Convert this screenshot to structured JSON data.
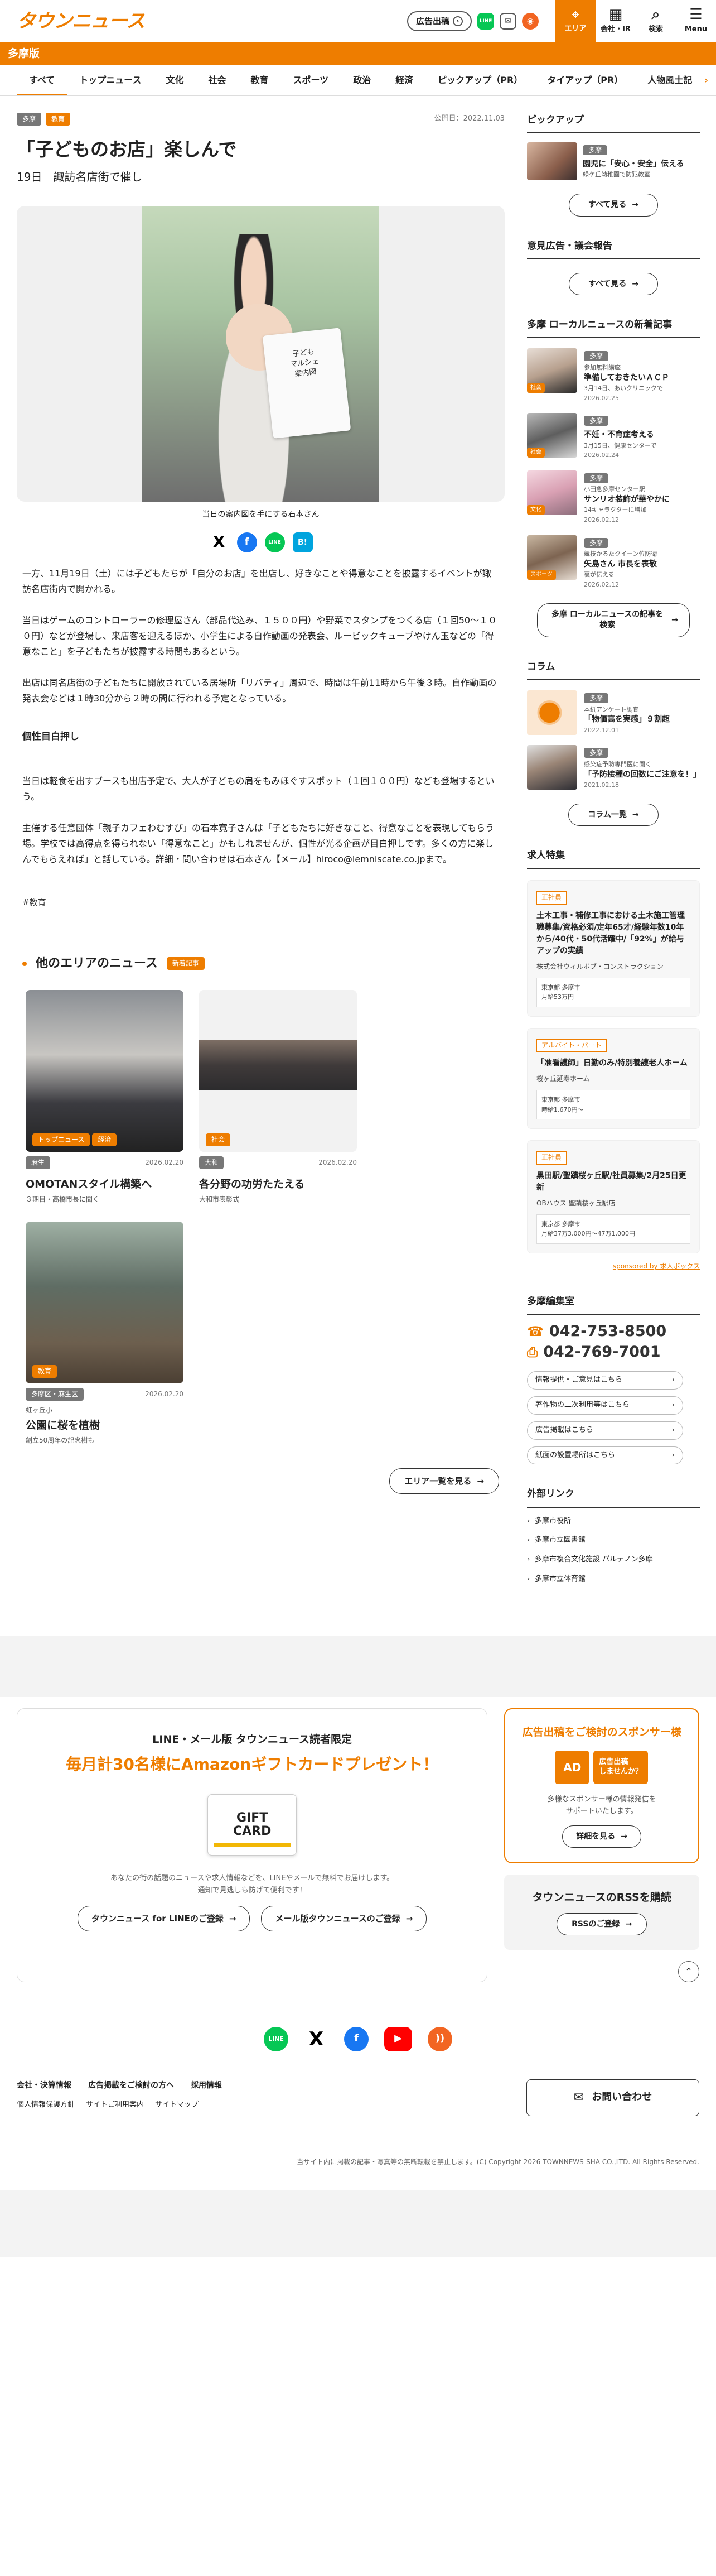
{
  "header": {
    "logo": "タウンニュース",
    "ad_pill": "広告出稿",
    "line_label": "LINE",
    "nav": [
      {
        "label": "エリア",
        "icon": "⌖"
      },
      {
        "label": "会社・IR",
        "icon": "▦"
      },
      {
        "label": "検索",
        "icon": "⌕"
      },
      {
        "label": "Menu",
        "icon": "☰"
      }
    ]
  },
  "edition": "多摩版",
  "categories": [
    "すべて",
    "トップニュース",
    "文化",
    "社会",
    "教育",
    "スポーツ",
    "政治",
    "経済",
    "ピックアップ（PR）",
    "タイアップ（PR）",
    "人物風土記"
  ],
  "categories_more": "›",
  "article": {
    "tags": [
      "多摩",
      "教育"
    ],
    "published": "公開日：2022.11.03",
    "title": "「子どものお店」楽しんで",
    "subtitle": "19日　諏訪名店街で催し",
    "photo_sign": "子ども\nマルシェ\n案内図",
    "caption": "当日の案内図を手にする石本さん",
    "share": {
      "x": "X",
      "fb": "f",
      "line": "LINE",
      "hatena": "B!"
    },
    "paragraphs": [
      "一方、11月19日（土）には子どもたちが「自分のお店」を出店し、好きなことや得意なことを披露するイベントが諏訪名店街内で開かれる。",
      "当日はゲームのコントローラーの修理屋さん（部品代込み、１５００円）や野菜でスタンプをつくる店（１回50～１００円）などが登場し、来店客を迎えるほか、小学生による自作動画の発表会、ルービックキューブやけん玉などの「得意なこと」を子どもたちが披露する時間もあるという。",
      "出店は同名店街の子どもたちに開放されている居場所「リバティ」周辺で、時間は午前11時から午後３時。自作動画の発表会などは１時30分から２時の間に行われる予定となっている。"
    ],
    "heading": "個性目白押し",
    "paragraphs2": [
      "当日は軽食を出すブースも出店予定で、大人が子どもの肩をもみほぐすスポット（１回１００円）なども登場するという。",
      "主催する任意団体「親子カフェわむすび」の石本寛子さんは「子どもたちに好きなこと、得意なことを表現してもらう場。学校では高得点を得られない「得意なこと」かもしれませんが、個性が光る企画が目白押しです。多くの方に楽しんでもらえれば」と話している。詳細・問い合わせは石本さん【メール】hiroco@lemniscate.co.jpまで。"
    ],
    "hashtag": "#教育"
  },
  "other_areas": {
    "title": "他のエリアのニュース",
    "badge": "新着記事",
    "cards": [
      {
        "chips": [
          "トップニュース",
          "経済"
        ],
        "area": "麻生",
        "date": "2026.02.20",
        "pre": "",
        "title": "OMOTANスタイル構築へ",
        "sub": "３期目・高橋市長に聞く"
      },
      {
        "chips": [
          "社会"
        ],
        "area": "大和",
        "date": "2026.02.20",
        "pre": "",
        "title": "各分野の功労たたえる",
        "sub": "大和市表彰式"
      },
      {
        "chips": [
          "教育"
        ],
        "area": "多摩区・麻生区",
        "date": "2026.02.20",
        "pre": "虹ヶ丘小",
        "title": "公園に桜を植樹",
        "sub": "創立50周年の記念樹も"
      }
    ],
    "list_button": "エリア一覧を見る"
  },
  "sidebar": {
    "pickup_title": "ピックアップ",
    "pickup_item": {
      "area": "多摩",
      "title": "園児に「安心・安全」伝える",
      "sub": "緑ケ丘幼稚園で防犯教室"
    },
    "see_all": "すべて見る",
    "opinion_title": "意見広告・議会報告",
    "local_title": "多摩 ローカルニュースの新着記事",
    "local_items": [
      {
        "area": "多摩",
        "chip": "社会",
        "pre": "参加無料講座",
        "title": "準備しておきたいＡＣＰ",
        "sub": "3月14日、あいクリニックで",
        "date": "2026.02.25"
      },
      {
        "area": "多摩",
        "chip": "社会",
        "pre": "",
        "title": "不妊・不育症考える",
        "sub": "3月15日、健康センターで",
        "date": "2026.02.24"
      },
      {
        "area": "多摩",
        "chip": "文化",
        "pre": "小田急多摩センター駅",
        "title": "サンリオ装飾が華やかに",
        "sub": "14キャラクターに増加",
        "date": "2026.02.12"
      },
      {
        "area": "多摩",
        "chip": "スポーツ",
        "pre": "競技かるたクイーン位防衛",
        "title": "矢島さん 市長を表敬",
        "sub": "裏が伝える",
        "date": "2026.02.12"
      }
    ],
    "local_button": "多摩 ローカルニュースの記事を検索",
    "column_title": "コラム",
    "column_items": [
      {
        "area": "多摩",
        "pre": "本紙アンケート調査",
        "title": "「物価高を実感」９割超",
        "date": "2022.12.01"
      },
      {
        "area": "多摩",
        "pre": "感染症予防専門医に聞く",
        "title": "「予防接種の回数にご注意を！」",
        "date": "2021.02.18"
      }
    ],
    "column_button": "コラム一覧",
    "jobs_title": "求人特集",
    "jobs": [
      {
        "type": "正社員",
        "title": "土木工事・補修工事における土木施工管理職募集/資格必須/定年65才/経験年数10年から/40代・50代活躍中/「92%」が給与アップの実績",
        "company": "株式会社ウィルボブ・コンストラクション",
        "loc": "東京都 多摩市",
        "pay": "月給53万円"
      },
      {
        "type": "アルバイト・パート",
        "title": "「准看護師」日勤のみ/特別養護老人ホーム",
        "company": "桜ヶ丘延寿ホーム",
        "loc": "東京都 多摩市",
        "pay": "時給1,670円～"
      },
      {
        "type": "正社員",
        "title": "黒田駅/聖蹟桜ヶ丘駅/社員募集/2月25日更新",
        "company": "OBハウス 聖蹟桜ヶ丘駅店",
        "loc": "東京都 多摩市",
        "pay": "月給37万3,000円～47万1,000円"
      }
    ],
    "sponsored": "sponsored by 求人ボックス",
    "office_title": "多摩編集室",
    "tel": "042-753-8500",
    "fax": "042-769-7001",
    "office_links": [
      "情報提供・ご意見はこちら",
      "著作物の二次利用等はこちら",
      "広告掲載はこちら",
      "紙面の設置場所はこちら"
    ],
    "ext_title": "外部リンク",
    "ext_links": [
      "多摩市役所",
      "多摩市立図書館",
      "多摩市複合文化施設 パルテノン多摩",
      "多摩市立体育館"
    ]
  },
  "promo": {
    "line1": "LINE・メール版 タウンニュース読者限定",
    "line2": "毎月計30名様にAmazonギフトカードプレゼント！",
    "gift": "GIFT\nCARD",
    "desc": "あなたの街の話題のニュースや求人情報などを、LINEやメールで無料でお届けします。\n通知で見逃しも防げて便利です！",
    "btn_line": "タウンニュース for LINEのご登録",
    "btn_mail": "メール版タウンニュースのご登録"
  },
  "sponsor": {
    "title": "広告出稿をご検討のスポンサー様",
    "ad_box": "AD",
    "bubble": "広告出稿\nしませんか？",
    "desc": "多様なスポンサー様の情報発信を\nサポートいたします。",
    "btn": "詳細を見る"
  },
  "rss": {
    "title": "タウンニュースのRSSを購読",
    "btn": "RSSのご登録"
  },
  "footer": {
    "links1": [
      "会社・決算情報",
      "広告掲載をご検討の方へ",
      "採用情報"
    ],
    "links2": [
      "個人情報保護方針",
      "サイトご利用案内",
      "サイトマップ"
    ],
    "contact": "お問い合わせ",
    "copyright": "当サイト内に掲載の記事・写真等の無断転載を禁止します。(C) Copyright 2026 TOWNNEWS-SHA CO.,LTD. All Rights Reserved.",
    "social": {
      "line": "LINE",
      "x": "X",
      "fb": "f",
      "yt": "▶",
      "rss": "))"
    }
  },
  "colors": {
    "brand": "#ee7d00",
    "line": "#06c755",
    "facebook": "#1877f2"
  }
}
